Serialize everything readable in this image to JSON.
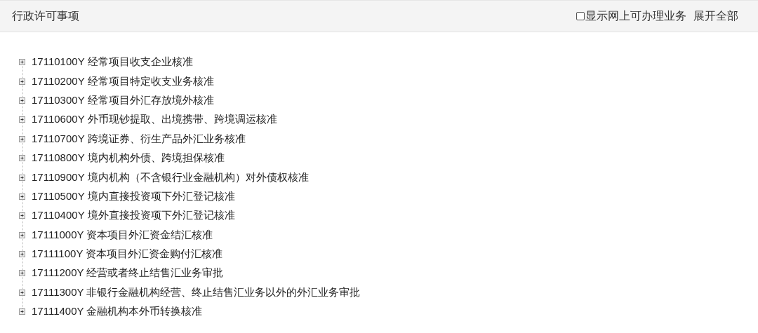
{
  "header": {
    "title": "行政许可事项",
    "online_filter": {
      "label": "显示网上可办理业务",
      "checked": false
    },
    "expand_all": "展开全部"
  },
  "tree": [
    {
      "code": "17110100Y",
      "name": "经常项目收支企业核准",
      "expanded": false
    },
    {
      "code": "17110200Y",
      "name": "经常项目特定收支业务核准",
      "expanded": false
    },
    {
      "code": "17110300Y",
      "name": "经常项目外汇存放境外核准",
      "expanded": false
    },
    {
      "code": "17110600Y",
      "name": "外币现钞提取、出境携带、跨境调运核准",
      "expanded": false
    },
    {
      "code": "17110700Y",
      "name": "跨境证券、衍生产品外汇业务核准",
      "expanded": false
    },
    {
      "code": "17110800Y",
      "name": "境内机构外债、跨境担保核准",
      "expanded": false
    },
    {
      "code": "17110900Y",
      "name": "境内机构（不含银行业金融机构）对外债权核准",
      "expanded": false
    },
    {
      "code": "17110500Y",
      "name": "境内直接投资项下外汇登记核准",
      "expanded": false
    },
    {
      "code": "17110400Y",
      "name": "境外直接投资项下外汇登记核准",
      "expanded": false
    },
    {
      "code": "17111000Y",
      "name": "资本项目外汇资金结汇核准",
      "expanded": false
    },
    {
      "code": "17111100Y",
      "name": "资本项目外汇资金购付汇核准",
      "expanded": false
    },
    {
      "code": "17111200Y",
      "name": "经营或者终止结售汇业务审批",
      "expanded": false
    },
    {
      "code": "17111300Y",
      "name": "非银行金融机构经营、终止结售汇业务以外的外汇业务审批",
      "expanded": false
    },
    {
      "code": "17111400Y",
      "name": "金融机构本外币转换核准",
      "expanded": false
    }
  ]
}
